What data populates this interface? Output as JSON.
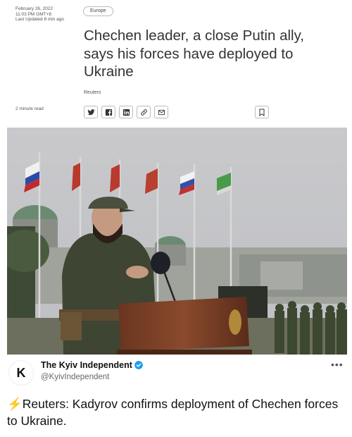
{
  "article": {
    "date": "February 26, 2022",
    "time": "11:03 PM GMT+8",
    "updated": "Last Updated 8 min ago",
    "tag": "Europe",
    "headline": "Chechen leader, a close Putin ally, says his forces have deployed to Ukraine",
    "byline": "Reuters",
    "read_time": "2 minute read"
  },
  "share": {
    "icons": [
      "twitter-icon",
      "facebook-icon",
      "linkedin-icon",
      "link-icon",
      "email-icon"
    ],
    "bookmark_icon": "bookmark-icon"
  },
  "tweet": {
    "avatar_letter": "K",
    "account_name": "The Kyiv Independent",
    "handle": "@KyivIndependent",
    "more": "•••",
    "bolt": "⚡",
    "text": "Reuters: Kadyrov confirms deployment of Chechen forces to Ukraine."
  },
  "colors": {
    "verified": "#1d9bf0",
    "bolt": "#f5a623"
  }
}
